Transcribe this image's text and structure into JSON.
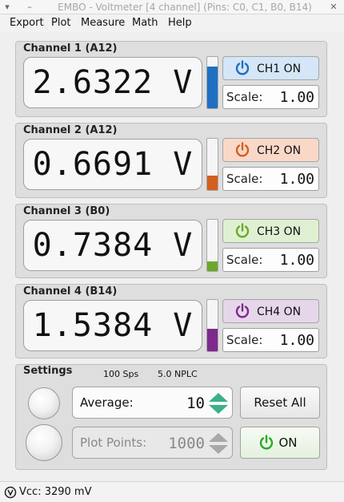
{
  "window": {
    "title": "EMBO - Voltmeter [4 channel] (Pins: C0, C1, B0, B14)",
    "left_control_1": "▾",
    "left_control_2": "–",
    "close_control": "✕"
  },
  "menu": [
    "Export",
    "Plot",
    "Measure",
    "Math",
    "Help"
  ],
  "channels": [
    {
      "title": "Channel 1 (A12)",
      "reading": "2.6322 V",
      "button_label": "CH1 ON",
      "scale_label": "Scale:",
      "scale_value": "1.00",
      "accent": "#1e6fc2",
      "button_bg": "#d4e6f7",
      "level": 0.82
    },
    {
      "title": "Channel 2  (A12)",
      "reading": "0.6691 V",
      "button_label": "CH2 ON",
      "scale_label": "Scale:",
      "scale_value": "1.00",
      "accent": "#d35f1f",
      "button_bg": "#f9d8c8",
      "level": 0.28
    },
    {
      "title": "Channel 3 (B0)",
      "reading": "0.7384 V",
      "button_label": "CH3 ON",
      "scale_label": "Scale:",
      "scale_value": "1.00",
      "accent": "#6aa82c",
      "button_bg": "#dff0d2",
      "level": 0.19
    },
    {
      "title": "Channel 4 (B14)",
      "reading": "1.5384 V",
      "button_label": "CH4 ON",
      "scale_label": "Scale:",
      "scale_value": "1.00",
      "accent": "#7d2a8c",
      "button_bg": "#e6d6ea",
      "level": 0.44
    }
  ],
  "settings": {
    "title": "Settings",
    "sample_rate": "100 Sps",
    "nplc": "5.0 NPLC",
    "average_label": "Average:",
    "average_value": "10",
    "plot_points_label": "Plot Points:",
    "plot_points_value": "1000",
    "reset_label": "Reset All",
    "on_label": "ON",
    "accent": "#2aa82a"
  },
  "status": {
    "vcc_text": "Vcc: 3290 mV"
  }
}
